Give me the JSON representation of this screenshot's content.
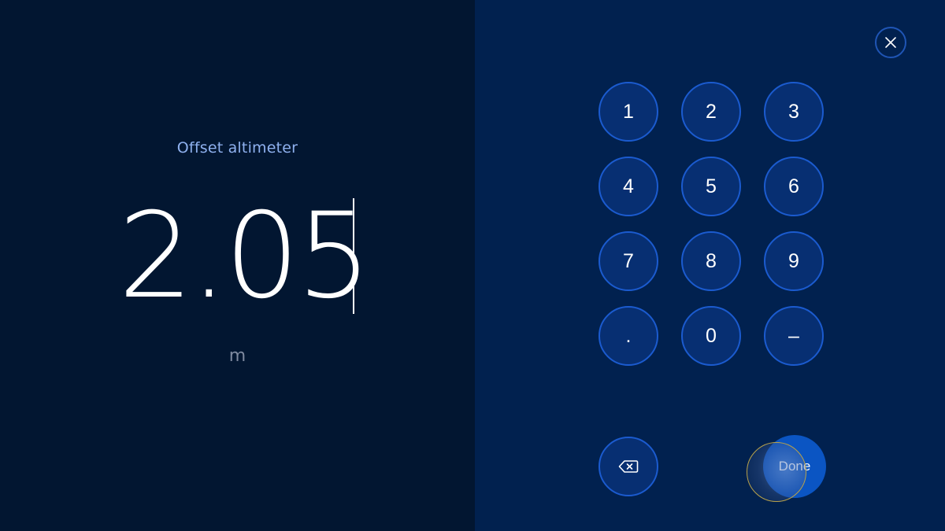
{
  "entry": {
    "label": "Offset altimeter",
    "value": "2.05",
    "unit": "m"
  },
  "keypad": {
    "keys": [
      "1",
      "2",
      "3",
      "4",
      "5",
      "6",
      "7",
      "8",
      "9",
      ".",
      "0",
      "–"
    ],
    "done_label": "Done",
    "backspace_icon": "backspace-icon",
    "close_icon": "close-icon"
  },
  "colors": {
    "left_background": "#021631",
    "right_background": "#01214f",
    "key_fill": "#072f72",
    "key_border": "#1b5bcf",
    "done_fill": "#0b55c3",
    "label_color": "#8fb1ef"
  }
}
